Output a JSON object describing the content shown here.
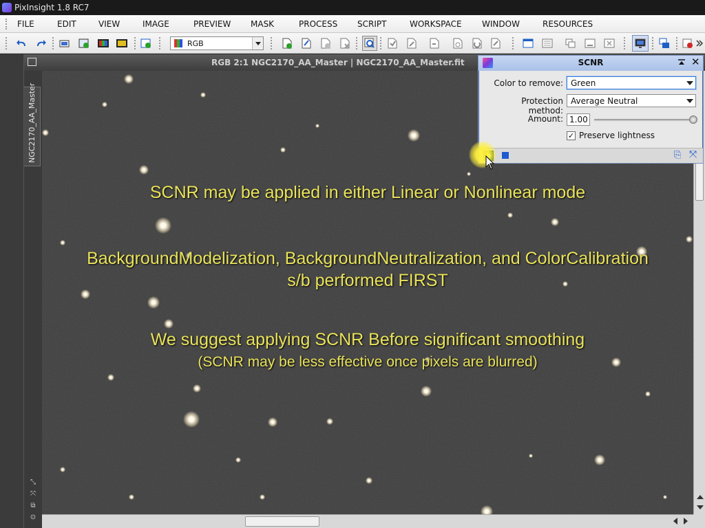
{
  "app": {
    "title": "PixInsight 1.8 RC7"
  },
  "menu": [
    "FILE",
    "EDIT",
    "VIEW",
    "IMAGE",
    "PREVIEW",
    "MASK",
    "PROCESS",
    "SCRIPT",
    "WORKSPACE",
    "WINDOW",
    "RESOURCES"
  ],
  "toolbar": {
    "channel_combo": "RGB"
  },
  "image_window": {
    "title": "RGB 2:1 NGC2170_AA_Master | NGC2170_AA_Master.fit",
    "view_tab": "NGC2170_AA_Master"
  },
  "captions": {
    "line1": "SCNR may be applied in either Linear or Nonlinear mode",
    "line2": "BackgroundModelization, BackgroundNeutralization, and ColorCalibration",
    "line3": "s/b performed FIRST",
    "line4": "We suggest applying SCNR Before significant smoothing",
    "line5": "(SCNR may be less effective once pixels are blurred)"
  },
  "scnr": {
    "title": "SCNR",
    "color_to_remove_label": "Color to remove:",
    "color_to_remove_value": "Green",
    "protection_label": "Protection method:",
    "protection_value": "Average Neutral",
    "amount_label": "Amount:",
    "amount_value": "1.00",
    "amount_level": 1.0,
    "preserve_label": "Preserve lightness",
    "preserve_checked": true
  },
  "colors": {
    "caption": "#e9e35a",
    "dialog_title": "#b6cbee",
    "execute": "#2f6d2f",
    "global": "#1e5ad0"
  }
}
